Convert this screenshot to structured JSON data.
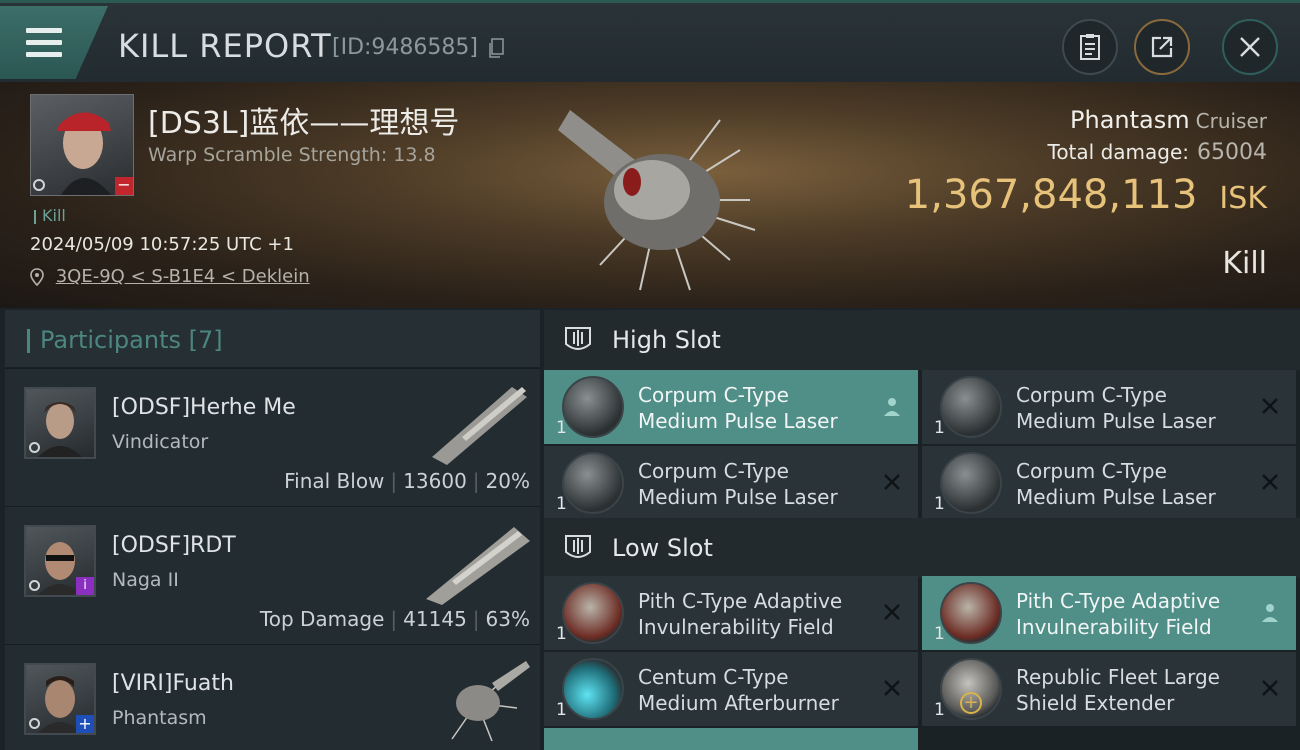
{
  "header": {
    "title": "KILL REPORT",
    "report_id": "[ID:9486585]"
  },
  "victim": {
    "name": "[DS3L]蓝依——理想号",
    "warp_scramble": "Warp Scramble Strength: 13.8",
    "result_tag": "Kill",
    "timestamp": "2024/05/09 10:57:25 UTC +1",
    "location": "3QE-9Q < S-B1E4 < Deklein",
    "ship_name": "Phantasm",
    "ship_class": "Cruiser",
    "total_damage_label": "Total damage:",
    "total_damage": "65004",
    "isk_value": "1,367,848,113",
    "isk_unit": "ISK",
    "result": "Kill"
  },
  "participants": {
    "title": "Participants",
    "count": "[7]",
    "rows": [
      {
        "name": "[ODSF]Herhe Me",
        "ship": "Vindicator",
        "role": "Final Blow",
        "damage": "13600",
        "percent": "20%"
      },
      {
        "name": "[ODSF]RDT",
        "ship": "Naga II",
        "role": "Top Damage",
        "damage": "41145",
        "percent": "63%"
      },
      {
        "name": "[VIRI]Fuath",
        "ship": "Phantasm",
        "role": "",
        "damage": "",
        "percent": ""
      }
    ]
  },
  "fitting": {
    "high_slot_label": "High Slot",
    "low_slot_label": "Low Slot",
    "high": [
      {
        "line1": "Corpum C-Type",
        "line2": "Medium Pulse Laser",
        "qty": "1",
        "status": "dropped"
      },
      {
        "line1": "Corpum C-Type",
        "line2": "Medium Pulse Laser",
        "qty": "1",
        "status": "destroyed"
      },
      {
        "line1": "Corpum C-Type",
        "line2": "Medium Pulse Laser",
        "qty": "1",
        "status": "destroyed"
      },
      {
        "line1": "Corpum C-Type",
        "line2": "Medium Pulse Laser",
        "qty": "1",
        "status": "destroyed"
      }
    ],
    "low": [
      {
        "line1": "Pith C-Type Adaptive",
        "line2": "Invulnerability Field",
        "qty": "1",
        "status": "destroyed"
      },
      {
        "line1": "Pith C-Type Adaptive",
        "line2": "Invulnerability Field",
        "qty": "1",
        "status": "dropped"
      },
      {
        "line1": "Centum C-Type",
        "line2": "Medium Afterburner",
        "qty": "1",
        "status": "destroyed"
      },
      {
        "line1": "Republic Fleet Large",
        "line2": "Shield Extender",
        "qty": "1",
        "status": "destroyed"
      }
    ]
  },
  "colors": {
    "accent": "#4f8f87",
    "isk": "#e6c27a",
    "background": "#1c2328"
  }
}
